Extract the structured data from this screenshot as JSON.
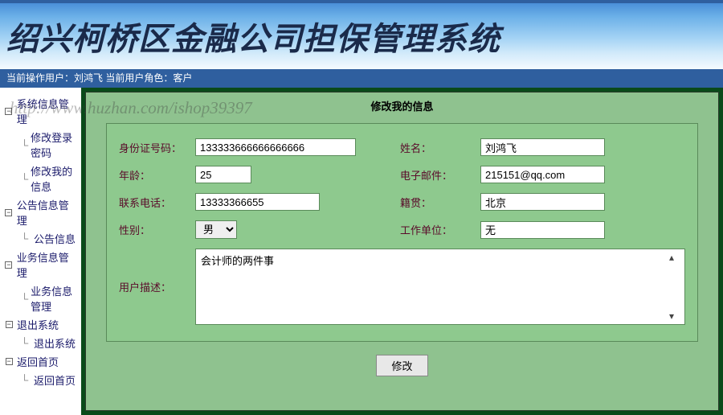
{
  "header": {
    "title": "绍兴柯桥区金融公司担保管理系统"
  },
  "watermark": "http://www.huzhan.com/ishop39397",
  "statusbar": {
    "user_label": "当前操作用户：",
    "user_value": "刘鸿飞",
    "role_label": "当前用户角色：",
    "role_value": "客户"
  },
  "sidebar": {
    "groups": [
      {
        "label": "系统信息管理",
        "children": [
          "修改登录密码",
          "修改我的信息"
        ]
      },
      {
        "label": "公告信息管理",
        "children": [
          "公告信息"
        ]
      },
      {
        "label": "业务信息管理",
        "children": [
          "业务信息管理"
        ]
      },
      {
        "label": "退出系统",
        "children": [
          "退出系统"
        ]
      },
      {
        "label": "返回首页",
        "children": [
          "返回首页"
        ]
      }
    ]
  },
  "panel": {
    "title": "修改我的信息"
  },
  "form": {
    "id_label": "身份证号码：",
    "id_value": "133333666666666666",
    "name_label": "姓名：",
    "name_value": "刘鸿飞",
    "age_label": "年龄：",
    "age_value": "25",
    "email_label": "电子邮件：",
    "email_value": "215151@qq.com",
    "phone_label": "联系电话：",
    "phone_value": "13333366655",
    "native_label": "籍贯：",
    "native_value": "北京",
    "gender_label": "性别：",
    "gender_value": "男",
    "work_label": "工作单位：",
    "work_value": "无",
    "desc_label": "用户描述：",
    "desc_value": "会计师的两件事",
    "submit": "修改"
  }
}
